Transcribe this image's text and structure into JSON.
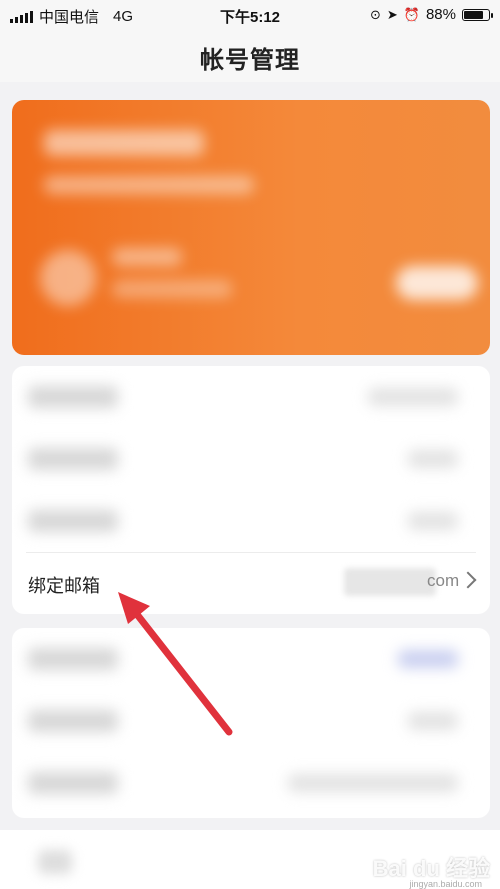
{
  "status_bar": {
    "carrier": "中国电信",
    "network": "4G",
    "time": "下午5:12",
    "battery_percent": "88%",
    "battery_level": 0.88
  },
  "nav": {
    "title": "帐号管理"
  },
  "settings": {
    "email_row": {
      "label": "绑定邮箱",
      "value_suffix": "com"
    }
  },
  "watermark": {
    "text": "Bai du 经验",
    "sub": "jingyan.baidu.com"
  },
  "colors": {
    "card_orange": "#f06d1c",
    "arrow_red": "#e0323c"
  }
}
